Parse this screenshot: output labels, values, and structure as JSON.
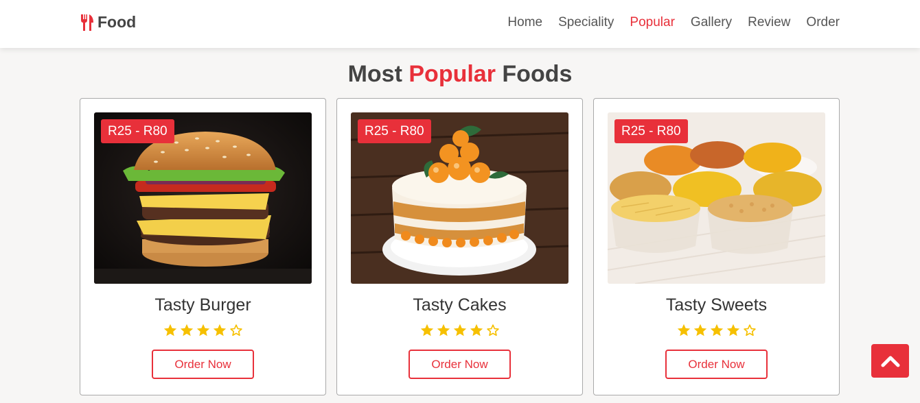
{
  "header": {
    "logo_text": "Food",
    "logo_icon": "utensils-icon",
    "nav": [
      {
        "label": "Home",
        "active": false
      },
      {
        "label": "Speciality",
        "active": false
      },
      {
        "label": "Popular",
        "active": true
      },
      {
        "label": "Gallery",
        "active": false
      },
      {
        "label": "Review",
        "active": false
      },
      {
        "label": "Order",
        "active": false
      }
    ]
  },
  "section": {
    "title_pre": "Most",
    "title_accent": "Popular",
    "title_post": "Foods"
  },
  "cards": [
    {
      "title": "Tasty Burger",
      "price": "R25 - R80",
      "rating": 4,
      "max_rating": 5,
      "button": "Order Now",
      "image": "burger-image"
    },
    {
      "title": "Tasty Cakes",
      "price": "R25 - R80",
      "rating": 4,
      "max_rating": 5,
      "button": "Order Now",
      "image": "cake-image"
    },
    {
      "title": "Tasty Sweets",
      "price": "R25 - R80",
      "rating": 4,
      "max_rating": 5,
      "button": "Order Now",
      "image": "sweets-image"
    }
  ],
  "scroll_top": {
    "icon": "chevron-up-icon"
  },
  "colors": {
    "accent": "#e8303a",
    "star": "#f6c000",
    "text": "#444444",
    "background": "#f7f6f5"
  }
}
